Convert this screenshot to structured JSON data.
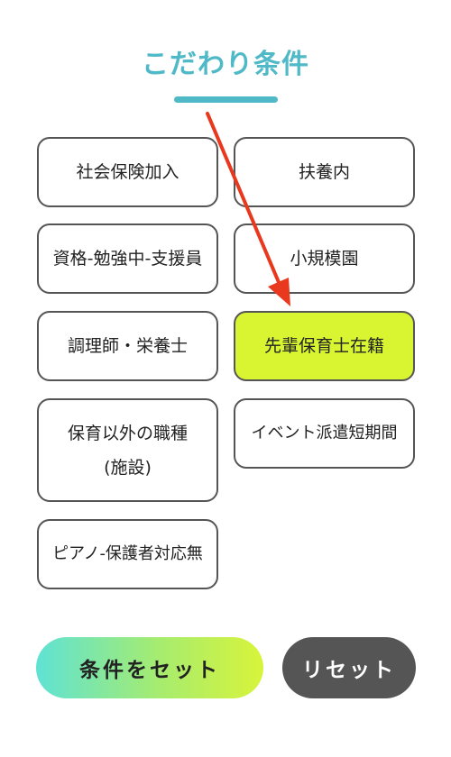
{
  "header": {
    "title": "こだわり条件"
  },
  "options": [
    {
      "label": "社会保険加入",
      "selected": false
    },
    {
      "label": "扶養内",
      "selected": false
    },
    {
      "label": "資格-勉強中-支援員",
      "selected": false
    },
    {
      "label": "小規模園",
      "selected": false
    },
    {
      "label": "調理師・栄養士",
      "selected": false
    },
    {
      "label": "先輩保育士在籍",
      "selected": true
    },
    {
      "label_line1": "保育以外の職種",
      "label_line2": "(施設)",
      "selected": false
    },
    {
      "label": "イベント派遣短期間",
      "selected": false
    },
    {
      "label": "ピアノ-保護者対応無",
      "selected": false
    }
  ],
  "actions": {
    "set_label": "条件をセット",
    "reset_label": "リセット"
  },
  "colors": {
    "accent": "#4fb9c7",
    "selected": "#d9f532",
    "annotation_arrow": "#e8391f",
    "reset_bg": "#555555"
  }
}
